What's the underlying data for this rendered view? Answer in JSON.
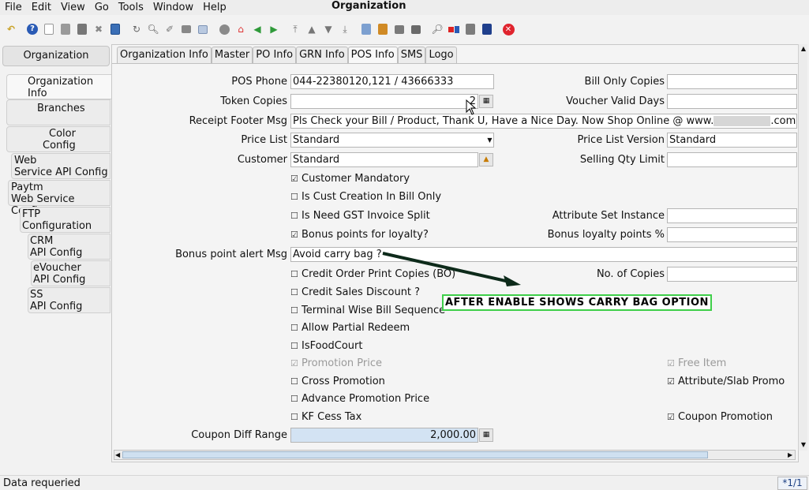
{
  "window_title": "Organization",
  "menu": {
    "file": "File",
    "edit": "Edit",
    "view": "View",
    "go": "Go",
    "tools": "Tools",
    "window": "Window",
    "help": "Help"
  },
  "sidebar": {
    "header": "Organization",
    "items": [
      {
        "line1": "Organization",
        "line2": "Info"
      },
      {
        "line1": "Branches",
        "line2": ""
      },
      {
        "line1": "Color",
        "line2": "Config"
      },
      {
        "line1": "Web",
        "line2": "Service API Config"
      },
      {
        "line1": "Paytm",
        "line2": "Web Service Config"
      },
      {
        "line1": "FTP",
        "line2": "Configuration"
      },
      {
        "line1": "CRM",
        "line2": "API Config"
      },
      {
        "line1": "eVoucher",
        "line2": "API Config"
      },
      {
        "line1": "SS",
        "line2": "API Config"
      }
    ]
  },
  "tabs": [
    "Organization Info",
    "Master",
    "PO Info",
    "GRN Info",
    "POS Info",
    "SMS",
    "Logo"
  ],
  "form": {
    "pos_phone_label": "POS Phone",
    "pos_phone_value": "044-22380120,121 / 43666333",
    "token_copies_label": "Token Copies",
    "token_copies_value": "2",
    "receipt_footer_label": "Receipt Footer Msg",
    "receipt_footer_value_start": "Pls Check your Bill / Product, Thank U, Have a Nice Day. Now Shop Online @ www.",
    "receipt_footer_value_end": ".com",
    "price_list_label": "Price List",
    "price_list_value": "Standard",
    "customer_label": "Customer",
    "customer_value": "Standard",
    "bill_only_copies_label": "Bill Only Copies",
    "voucher_valid_days_label": "Voucher Valid Days",
    "price_list_version_label": "Price List Version",
    "price_list_version_value": "Standard",
    "selling_qty_limit_label": "Selling Qty Limit",
    "attribute_set_instance_label": "Attribute Set Instance",
    "bonus_loyalty_points_label": "Bonus loyalty points %",
    "bonus_alert_label": "Bonus point alert Msg",
    "bonus_alert_value": "Avoid carry bag ?",
    "no_of_copies_label": "No. of Copies",
    "coupon_diff_range_label": "Coupon Diff Range",
    "coupon_diff_range_value": "2,000.00"
  },
  "checkboxes": {
    "customer_mandatory": "Customer Mandatory",
    "cust_creation_in_bill": "Is Cust Creation In Bill Only",
    "gst_invoice_split": "Is Need GST Invoice Split",
    "bonus_points_loyalty": "Bonus points for loyalty?",
    "credit_order_print": "Credit Order Print Copies (BO)",
    "credit_sales_discount": "Credit Sales Discount ?",
    "terminal_wise_bill": "Terminal Wise Bill Sequence",
    "allow_partial_redeem": "Allow Partial Redeem",
    "is_food_court": "IsFoodCourt",
    "promotion_price": "Promotion Price",
    "cross_promotion": "Cross Promotion",
    "advance_promotion_price": "Advance Promotion Price",
    "kf_cess_tax": "KF Cess Tax",
    "free_item": "Free Item",
    "attribute_slab_promo": "Attribute/Slab Promo",
    "coupon_promotion": "Coupon Promotion"
  },
  "annotation": "AFTER ENABLE SHOWS CARRY BAG OPTION",
  "status": {
    "message": "Data requeried",
    "page": "*1/1"
  },
  "colors": {
    "annotation_border": "#3fcf4a",
    "arrow": "#0d2a1a",
    "coupon_field_bg": "#d3e3f3",
    "close_icon": "#e0242e"
  }
}
